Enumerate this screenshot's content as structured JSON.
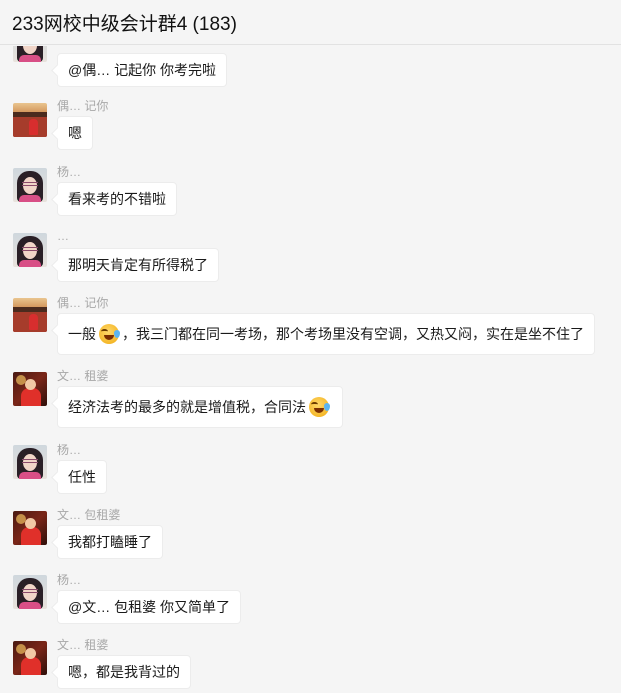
{
  "header": {
    "title": "233网校中级会计群4 (183)"
  },
  "messages": [
    {
      "avatar": "woman",
      "sender": "",
      "text": "@偶… 记起你 你考完啦"
    },
    {
      "avatar": "palace",
      "sender": "偶… 记你",
      "text": "嗯"
    },
    {
      "avatar": "woman",
      "sender": "杨…",
      "text": "看来考的不错啦"
    },
    {
      "avatar": "woman",
      "sender": "…",
      "text": "那明天肯定有所得税了"
    },
    {
      "avatar": "palace",
      "sender": "偶… 记你",
      "text_a": "一般",
      "text_b": "，我三门都在同一考场，那个考场里没有空调，又热又闷，实在是坐不住了"
    },
    {
      "avatar": "red",
      "sender": "文… 租婆",
      "text": "经济法考的最多的就是增值税，合同法"
    },
    {
      "avatar": "woman",
      "sender": "杨…",
      "text": "任性"
    },
    {
      "avatar": "red",
      "sender": "文… 包租婆",
      "text": "我都打瞌睡了"
    },
    {
      "avatar": "woman",
      "sender": "杨…",
      "text": "@文… 包租婆 你又简单了"
    },
    {
      "avatar": "red",
      "sender": "文… 租婆",
      "text": "嗯，都是我背过的"
    }
  ]
}
